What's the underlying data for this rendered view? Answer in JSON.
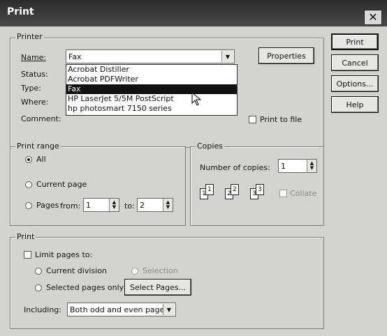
{
  "window": {
    "title": "Print",
    "close_icon": "close-icon"
  },
  "buttons": {
    "print": "Print",
    "cancel": "Cancel",
    "options": "Options...",
    "help": "Help"
  },
  "printer": {
    "legend": "Printer",
    "name_label": "Name:",
    "name_value": "Fax",
    "properties": "Properties",
    "status_label": "Status:",
    "type_label": "Type:",
    "where_label": "Where:",
    "comment_label": "Comment:",
    "print_to_file": "Print to file",
    "dropdown_items": [
      "Acrobat Distiller",
      "Acrobat PDFWriter",
      "Fax",
      "HP LaserJet 5/5M PostScript",
      "hp photosmart 7150 series"
    ],
    "selected_index": 2
  },
  "print_range": {
    "legend": "Print range",
    "all": "All",
    "current_page": "Current page",
    "pages": "Pages",
    "from_label": "from:",
    "from_value": "1",
    "to_label": "to:",
    "to_value": "2"
  },
  "copies": {
    "legend": "Copies",
    "number_label": "Number of copies:",
    "number_value": "1",
    "collate": "Collate",
    "page_icon_labels": [
      "1",
      "1",
      "2",
      "2",
      "3",
      "3"
    ]
  },
  "print_section": {
    "legend": "Print",
    "limit_pages": "Limit pages to:",
    "current_division": "Current division",
    "selection": "Selection",
    "selected_pages_only": "Selected pages only",
    "select_pages_button": "Select Pages...",
    "including_label": "Including:",
    "including_value": "Both odd and even pages"
  }
}
